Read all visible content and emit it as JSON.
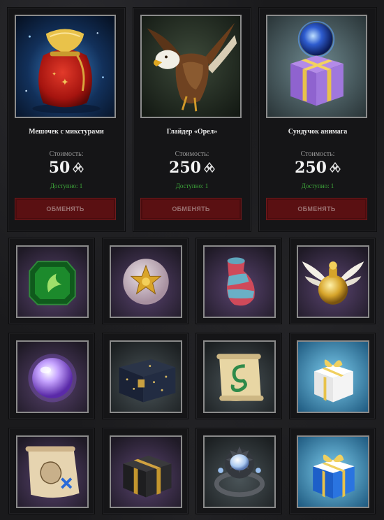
{
  "shop": {
    "cost_label": "Стоимость:",
    "exchange_label": "ОБМЕНЯТЬ",
    "items": [
      {
        "name": "Мешочек с микстурами",
        "price": "50",
        "available": "Доступно: 1",
        "icon": "potion-pouch-icon"
      },
      {
        "name": "Глайдер «Орел»",
        "price": "250",
        "available": "Доступно: 1",
        "icon": "eagle-glider-icon"
      },
      {
        "name": "Сундучок анимага",
        "price": "250",
        "available": "Доступно: 1",
        "icon": "animagus-gift-box-icon"
      }
    ]
  },
  "grid": {
    "tiles": [
      {
        "icon": "green-gem-icon"
      },
      {
        "icon": "golden-star-orb-icon"
      },
      {
        "icon": "striped-vase-icon"
      },
      {
        "icon": "winged-golden-potion-icon"
      },
      {
        "icon": "purple-crystal-ball-icon"
      },
      {
        "icon": "dark-star-chest-icon"
      },
      {
        "icon": "serpent-scroll-icon"
      },
      {
        "icon": "white-gift-box-icon"
      },
      {
        "icon": "treasure-map-scroll-icon"
      },
      {
        "icon": "black-gold-box-icon"
      },
      {
        "icon": "moonstone-ring-icon"
      },
      {
        "icon": "blue-gift-box-icon"
      }
    ]
  },
  "colors": {
    "background": "#1a1a1c",
    "card": "#151517",
    "button": "#5a1012",
    "available_text": "#3ea83a"
  }
}
